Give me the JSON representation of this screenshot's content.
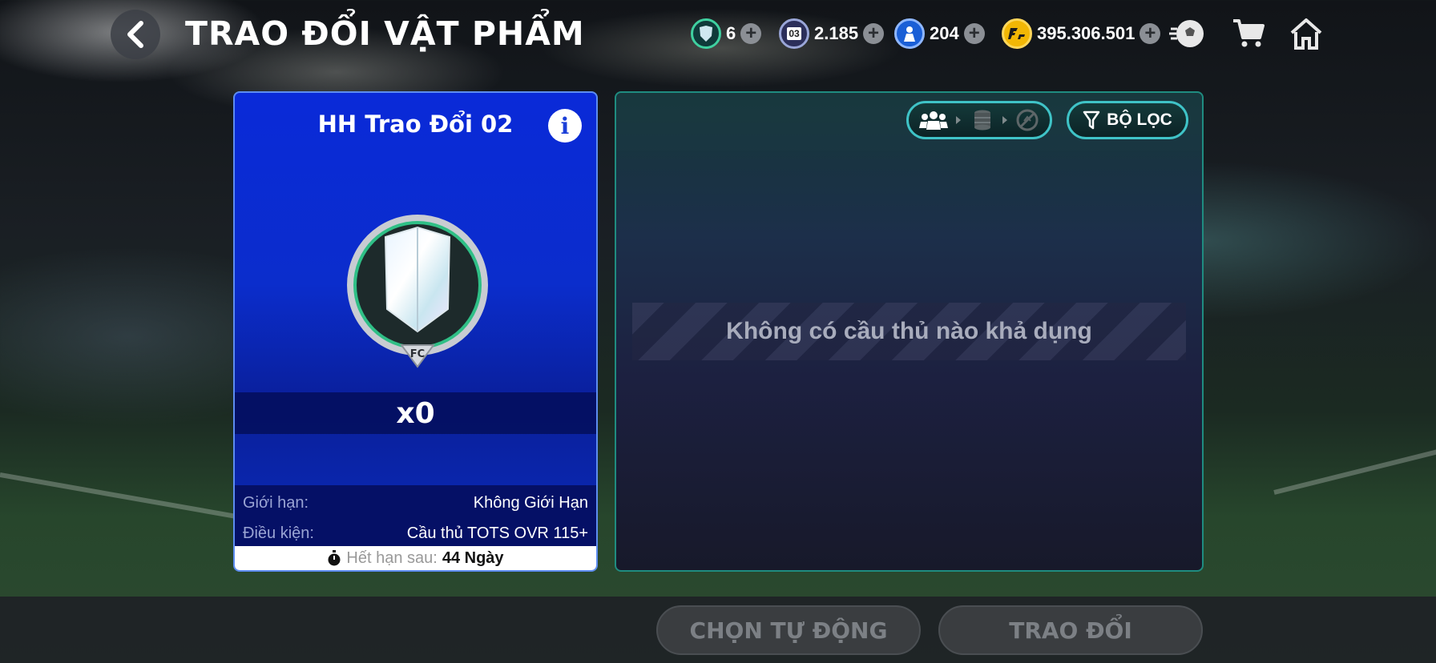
{
  "header": {
    "title": "TRAO ĐỔI VẬT PHẨM",
    "currencies": [
      {
        "icon": "shield-token-icon",
        "value": "6"
      },
      {
        "icon": "card-03-icon",
        "label": "03",
        "value": "2.185"
      },
      {
        "icon": "player-token-icon",
        "value": "204"
      },
      {
        "icon": "fc-coin-icon",
        "value": "395.306.501"
      }
    ]
  },
  "card": {
    "title": "HH Trao Đổi 02",
    "quantity": "x0",
    "limit_label": "Giới hạn:",
    "limit_value": "Không Giới Hạn",
    "condition_label": "Điều kiện:",
    "condition_value": "Cầu thủ TOTS OVR 115+",
    "expiry_label": "Hết hạn sau:",
    "expiry_value": "44 Ngày"
  },
  "panel": {
    "filter_label": "BỘ LỌC",
    "empty_message": "Không có cầu thủ nào khả dụng"
  },
  "actions": {
    "auto_select": "CHỌN TỰ ĐỘNG",
    "exchange": "TRAO ĐỔI"
  },
  "colors": {
    "card_blue": "#0b2dcc",
    "accent_teal": "#3fc3c7",
    "coin_gold": "#f2b705"
  }
}
